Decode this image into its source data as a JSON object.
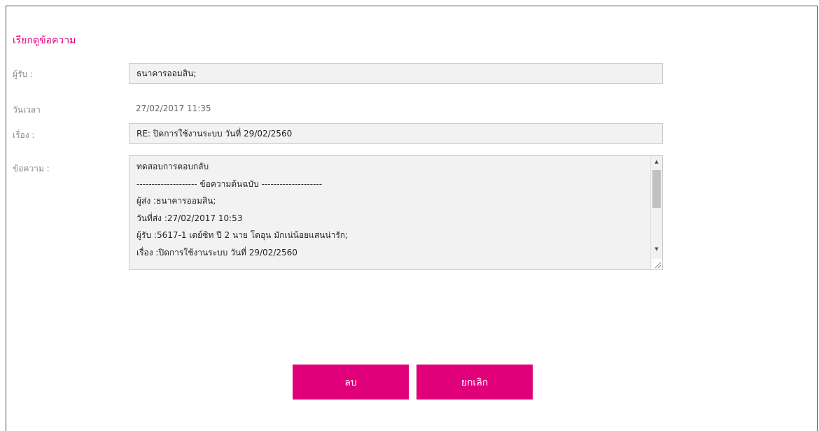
{
  "dialog": {
    "title": "เรียกดูข้อความ"
  },
  "fields": {
    "recipient": {
      "label": "ผู้รับ :",
      "value": "ธนาคารออมสิน;"
    },
    "datetime": {
      "label": "วันเวลา",
      "value": "27/02/2017 11:35"
    },
    "subject": {
      "label": "เรื่อง :",
      "value": "RE: ปิดการใช้งานระบบ วันที่ 29/02/2560"
    },
    "message": {
      "label": "ข้อความ :",
      "lines": [
        "ทดสอบการตอบกลับ",
        "-------------------- ข้อความต้นฉบับ --------------------",
        "ผู้ส่ง :ธนาคารออมสิน;",
        "วันที่ส่ง :27/02/2017 10:53",
        "ผู้รับ :5617-1 เดย์ซิท ปี 2 นาย โดอุน มักเน่น้อยแสนน่ารัก;",
        "เรื่อง :ปิดการใช้งานระบบ วันที่ 29/02/2560"
      ],
      "scroll_position": 0.1
    }
  },
  "buttons": {
    "delete_label": "ลบ",
    "cancel_label": "ยกเลิก"
  },
  "icons": {
    "scroll_up": "scroll-up-arrow-icon",
    "scroll_down": "scroll-down-arrow-icon",
    "resize": "resize-grip-icon"
  },
  "colors": {
    "accent": "#e0007a",
    "field_bg": "#f2f2f2",
    "label_text": "#8a8a8a"
  }
}
